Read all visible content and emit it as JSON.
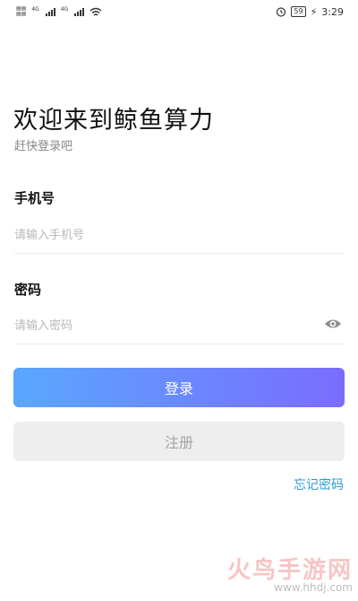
{
  "status_bar": {
    "carrier_top": "",
    "carrier_bottom": "",
    "sig1_label": "4G",
    "sig2_label": "4G",
    "battery": "59",
    "time": "3:29"
  },
  "header": {
    "title": "欢迎来到鲸鱼算力",
    "subtitle": "赶快登录吧"
  },
  "form": {
    "phone_label": "手机号",
    "phone_placeholder": "请输入手机号",
    "password_label": "密码",
    "password_placeholder": "请输入密码"
  },
  "actions": {
    "login_label": "登录",
    "register_label": "注册",
    "forgot_label": "忘记密码"
  },
  "watermark": {
    "logo": "火鸟手游网",
    "url": "www.hhdj.com"
  },
  "colors": {
    "login_gradient_start": "#5aa7ff",
    "login_gradient_end": "#7a6cff",
    "forgot_link": "#2a9bd6"
  }
}
